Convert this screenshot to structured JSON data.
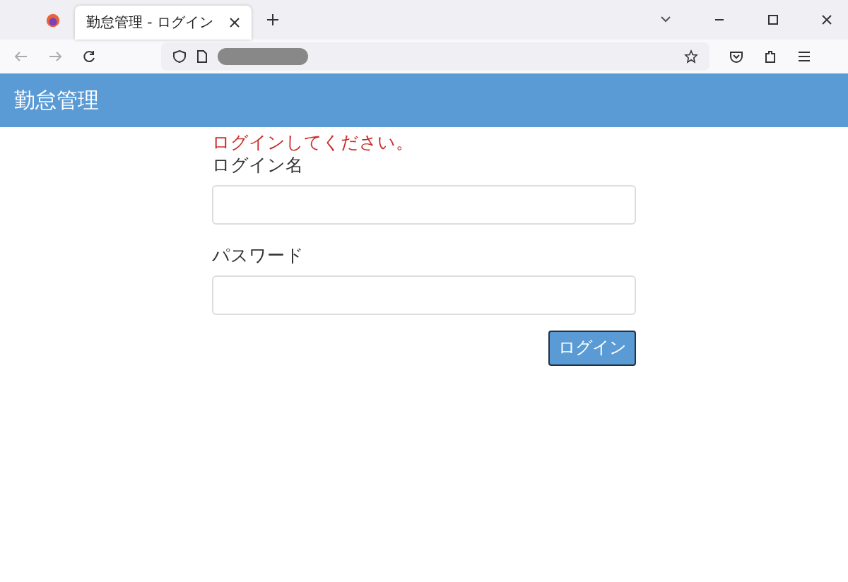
{
  "browser": {
    "tab": {
      "title": "勤怠管理 - ログイン",
      "selected": true
    }
  },
  "header": {
    "title": "勤怠管理"
  },
  "form": {
    "message": "ログインしてください。",
    "fields": [
      {
        "label": "ログイン名"
      },
      {
        "label": "パスワード"
      }
    ],
    "submit": "ログイン"
  }
}
